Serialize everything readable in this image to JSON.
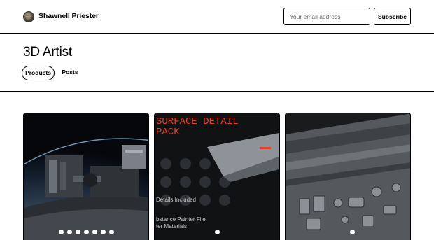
{
  "header": {
    "creator_name": "Shawnell Priester",
    "email_placeholder": "Your email address",
    "subscribe_label": "Subscribe"
  },
  "profile": {
    "title": "3D Artist",
    "tabs": [
      {
        "label": "Products",
        "active": true
      },
      {
        "label": "Posts",
        "active": false
      }
    ]
  },
  "products": [
    {
      "image": "space-station-render",
      "carousel_dots": 7
    },
    {
      "image": "surface-detail-pack-preview",
      "overlay_text": [
        "SURFACE DETAIL",
        "PACK",
        "Details Included",
        "bstance Painter File",
        "ter Materials"
      ],
      "carousel_dots": 1
    },
    {
      "image": "metal-panel-surface-render",
      "carousel_dots": 1
    }
  ],
  "colors": {
    "border": "#000000",
    "background": "#ffffff",
    "pack_title": "#e0432b"
  }
}
